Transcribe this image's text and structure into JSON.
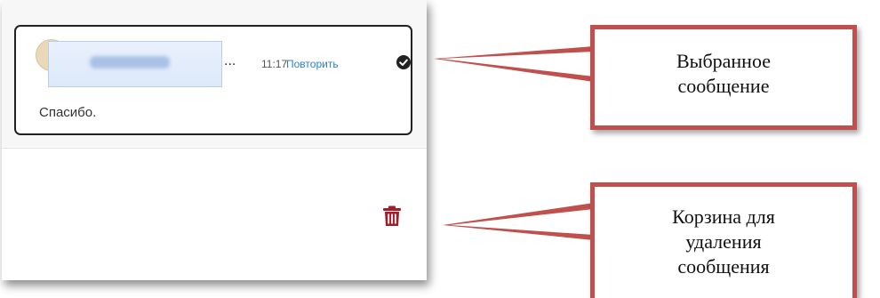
{
  "message": {
    "time": "11:17",
    "retry_label": "Повторить",
    "ellipsis": "...",
    "text": "Спасибо.",
    "status_icon": "check-circle-icon"
  },
  "actions": {
    "delete_icon": "trash-icon"
  },
  "callouts": {
    "selected_line1": "Выбранное",
    "selected_line2": "сообщение",
    "trash_line1": "Корзина для",
    "trash_line2": "удаления",
    "trash_line3": "сообщения"
  },
  "colors": {
    "callout_border": "#c0504d",
    "link": "#2a7fd5",
    "trash": "#a01e2a"
  }
}
